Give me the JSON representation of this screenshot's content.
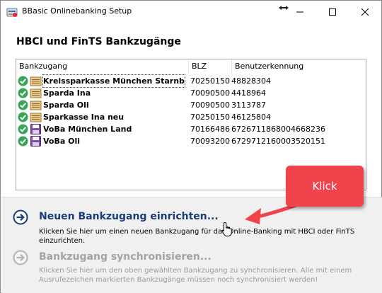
{
  "window": {
    "title": "BBasic Onlinebanking Setup",
    "controls": [
      "minimize",
      "maximize",
      "close"
    ]
  },
  "heading": "HBCI und FinTS Bankzugänge",
  "list": {
    "columns": [
      "Bankzugang",
      "BLZ",
      "Benutzerkennung"
    ],
    "rows": [
      {
        "name": "Kreissparkasse München Starnberg ...",
        "blz": "70250150",
        "user": "48828304",
        "status_icon": "check-icon",
        "type_icon": "folder-card-icon",
        "selected": true
      },
      {
        "name": "Sparda Ina",
        "blz": "70090500",
        "user": "4418964",
        "status_icon": "check-icon",
        "type_icon": "folder-card-icon",
        "selected": false
      },
      {
        "name": "Sparda Oli",
        "blz": "70090500",
        "user": "3113787",
        "status_icon": "check-icon",
        "type_icon": "folder-card-icon",
        "selected": false
      },
      {
        "name": "Sparkasse Ina neu",
        "blz": "70250150",
        "user": "46125804",
        "status_icon": "check-icon",
        "type_icon": "folder-card-icon",
        "selected": false
      },
      {
        "name": "VoBa München Land",
        "blz": "70166486",
        "user": "6726711868004668236",
        "status_icon": "check-icon",
        "type_icon": "floppy-disk-icon",
        "selected": false
      },
      {
        "name": "VoBa Oli",
        "blz": "70093200",
        "user": "6729712160003520151",
        "status_icon": "check-icon",
        "type_icon": "floppy-disk-icon",
        "selected": false
      }
    ]
  },
  "actions": {
    "new": {
      "title": "Neuen Bankzugang einrichten...",
      "desc": "Klicken Sie hier um einen neuen Bankzugang für das Online-Banking mit HBCI oder FinTS einzurichten.",
      "enabled": true
    },
    "sync": {
      "title": "Bankzugang synchronisieren...",
      "desc": "Klicken Sie hier um den oben gewählten Bankzugang zu synchronisieren. Alle mit einem Ausrufezeichen markierten Bankzugänge müssen noch synchronisiert werden!",
      "enabled": false
    }
  },
  "annotation": {
    "label": "Klick",
    "color": "#f0434c"
  },
  "colors": {
    "link_blue": "#1a3c78",
    "check_green": "#3aa55a",
    "disabled_text": "#a3a3a3"
  }
}
